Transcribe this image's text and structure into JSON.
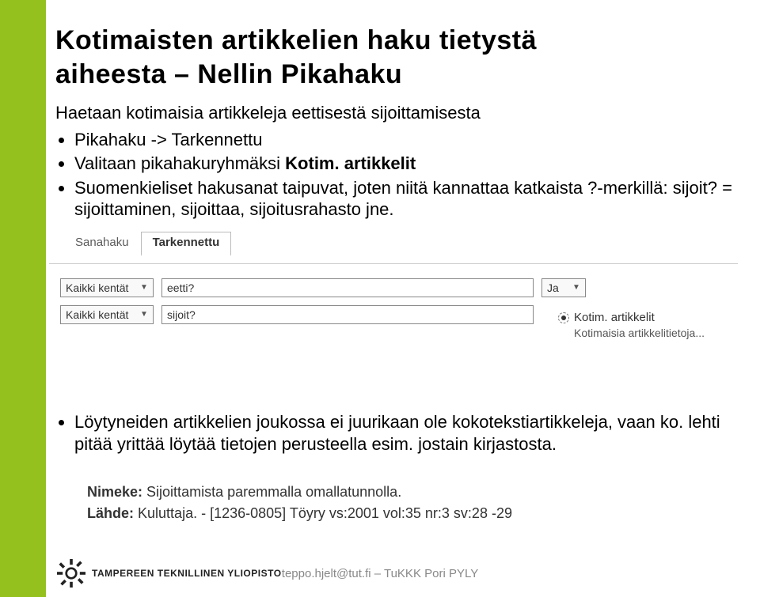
{
  "title_line1": "Kotimaisten artikkelien haku tietystä",
  "title_line2": "aiheesta – Nellin Pikahaku",
  "intro": "Haetaan kotimaisia artikkeleja eettisestä sijoittamisesta",
  "bullets": {
    "b1": "Pikahaku -> Tarkennettu",
    "b2": "Valitaan pikahakuryhmäksi Kotim. artikkelit",
    "b3": "Suomenkieliset hakusanat taipuvat, joten niitä kannattaa katkaista ?-merkillä: sijoit? = sijoittaminen, sijoittaa, sijoitusrahasto jne."
  },
  "tabs": {
    "sanahaku": "Sanahaku",
    "tarkennettu": "Tarkennettu"
  },
  "form": {
    "field_label": "Kaikki kentät",
    "row1_value": "eetti?",
    "row1_op": "Ja",
    "row2_value": "sijoit?"
  },
  "radio": {
    "label": "Kotim. artikkelit",
    "sub": "Kotimaisia artikkelitietoja..."
  },
  "bottom_bullet": "Löytyneiden artikkelien joukossa ei juurikaan ole kokotekstiartikkeleja, vaan ko. lehti pitää yrittää löytää tietojen perusteella esim. jostain kirjastosta.",
  "result": {
    "nimeke_label": "Nimeke:",
    "nimeke_value": "Sijoittamista paremmalla omallatunnolla.",
    "lahde_label": "Lähde:",
    "lahde_value": "Kuluttaja. - [1236-0805] Töyry vs:2001 vol:35 nr:3 sv:28 -29"
  },
  "footer": {
    "uni": "TAMPEREEN TEKNILLINEN YLIOPISTO",
    "center": "teppo.hjelt@tut.fi – TuKKK Pori PYLY"
  }
}
